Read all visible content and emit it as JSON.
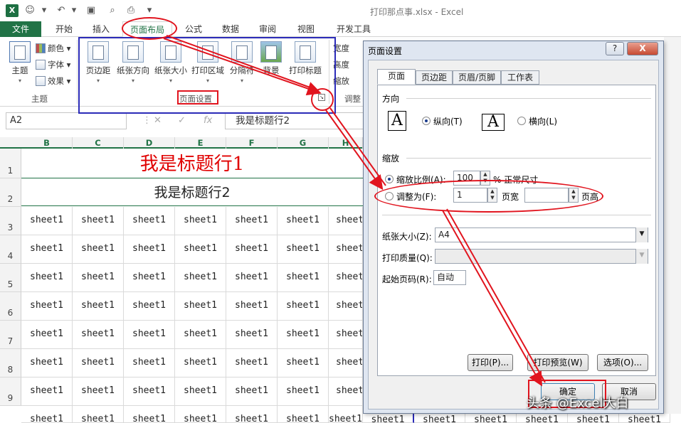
{
  "window": {
    "title": "打印那点事.xlsx - Excel",
    "logo": "X"
  },
  "tabs": [
    {
      "label": "文件"
    },
    {
      "label": "开始"
    },
    {
      "label": "插入"
    },
    {
      "label": "页面布局"
    },
    {
      "label": "公式"
    },
    {
      "label": "数据"
    },
    {
      "label": "审阅"
    },
    {
      "label": "视图"
    },
    {
      "label": "开发工具"
    }
  ],
  "ribbon": {
    "theme_group": {
      "theme_label": "主题",
      "colors": "颜色",
      "fonts": "字体",
      "effects": "效果",
      "group_label": "主题",
      "theme_icon_text": "文A"
    },
    "page_setup": {
      "buttons": [
        "页边距",
        "纸张方向",
        "纸张大小",
        "打印区域",
        "分隔符",
        "背景",
        "打印标题"
      ],
      "group_label": "页面设置"
    },
    "scale_group": {
      "width": "宽度",
      "height": "高度",
      "scale": "缩放",
      "group_label": "调整"
    },
    "right_partial": "纟"
  },
  "formula_bar": {
    "name_box": "A2",
    "fx": "fx",
    "content": "我是标题行2"
  },
  "sheet": {
    "columns": [
      "B",
      "C",
      "D",
      "E",
      "F",
      "G",
      "H"
    ],
    "row_numbers": [
      "1",
      "2",
      "3",
      "4",
      "5",
      "6",
      "7",
      "8",
      "9"
    ],
    "title_row1": "我是标题行1",
    "title_row2": "我是标题行2",
    "cell_text": "sheet1",
    "bottom_cells": [
      "sheet1",
      "sheet1",
      "sheet1",
      "sheet1",
      "sheet1",
      "sheet1"
    ]
  },
  "dialog": {
    "title": "页面设置",
    "help": "?",
    "close": "X",
    "tabs": [
      "页面",
      "页边距",
      "页眉/页脚",
      "工作表"
    ],
    "orientation": {
      "section": "方向",
      "portrait": "纵向(T)",
      "landscape": "横向(L)",
      "selected": "portrait"
    },
    "scaling": {
      "section": "缩放",
      "adjust_to_label": "缩放比例(A):",
      "adjust_value": "100",
      "adjust_suffix": "% 正常尺寸",
      "fit_to_label": "调整为(F):",
      "pages_wide": "1",
      "pages_wide_label": "页宽",
      "pages_tall": "",
      "pages_tall_label": "页高",
      "selected": "adjust"
    },
    "paper_size_label": "纸张大小(Z):",
    "paper_size": "A4",
    "print_quality_label": "打印质量(Q):",
    "print_quality": "",
    "first_page_label": "起始页码(R):",
    "first_page": "自动",
    "buttons": {
      "print": "打印(P)...",
      "preview": "打印预览(W)",
      "options": "选项(O)...",
      "ok": "确定",
      "cancel": "取消"
    }
  },
  "watermark": "头条 @Excel大白",
  "colors": {
    "excel_green": "#217346",
    "annotation_red": "#e1141e",
    "annotation_blue": "#2b2bb8",
    "title_red": "#e00000"
  }
}
